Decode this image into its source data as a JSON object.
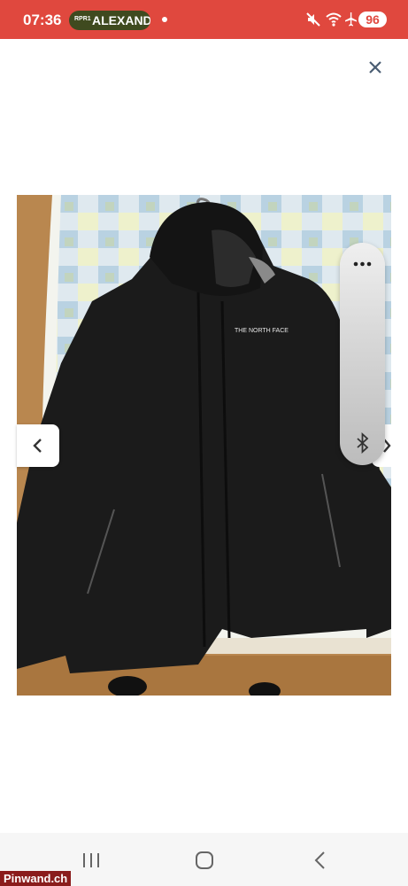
{
  "status_bar": {
    "time": "07:36",
    "notification_app": "RPR1",
    "notification_text": "ALEXANDER",
    "battery": "96",
    "icons": [
      "mute-icon",
      "wifi-icon",
      "airplane-icon"
    ]
  },
  "viewer": {
    "close_icon": "close-icon",
    "prev_icon": "chevron-left-icon",
    "next_icon": "chevron-right-icon",
    "photo_subject": "black softshell jacket on a hanger",
    "jacket_logo": "THE NORTH FACE"
  },
  "side_panel": {
    "menu_icon": "more-dots-icon",
    "bluetooth_icon": "bluetooth-icon"
  },
  "nav_bar": {
    "recents_icon": "recents-icon",
    "home_icon": "home-icon",
    "back_icon": "back-icon"
  },
  "watermark": "Pinwand.ch",
  "colors": {
    "status_bar_bg": "#e0483e",
    "pill_bg": "#3f4a1f",
    "jacket": "#1a1a1a",
    "floor": "#b9874f"
  }
}
